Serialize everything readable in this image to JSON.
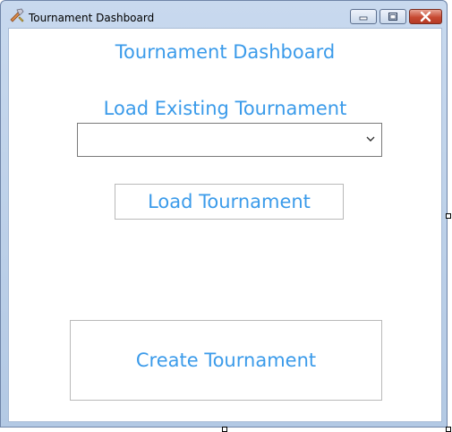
{
  "window": {
    "title": "Tournament Dashboard",
    "app_icon": "tools-icon",
    "controls": [
      "minimize-icon",
      "maximize-icon",
      "close-icon"
    ]
  },
  "main": {
    "page_title": "Tournament Dashboard",
    "load_section_label": "Load Existing Tournament",
    "tournament_select": {
      "value": "",
      "icon": "chevron-down-icon"
    },
    "load_button_label": "Load Tournament",
    "create_button_label": "Create Tournament"
  },
  "colors": {
    "accent_text": "#3b9bea",
    "title_bar": "#b3c9e4",
    "close_button": "#c74a33"
  }
}
